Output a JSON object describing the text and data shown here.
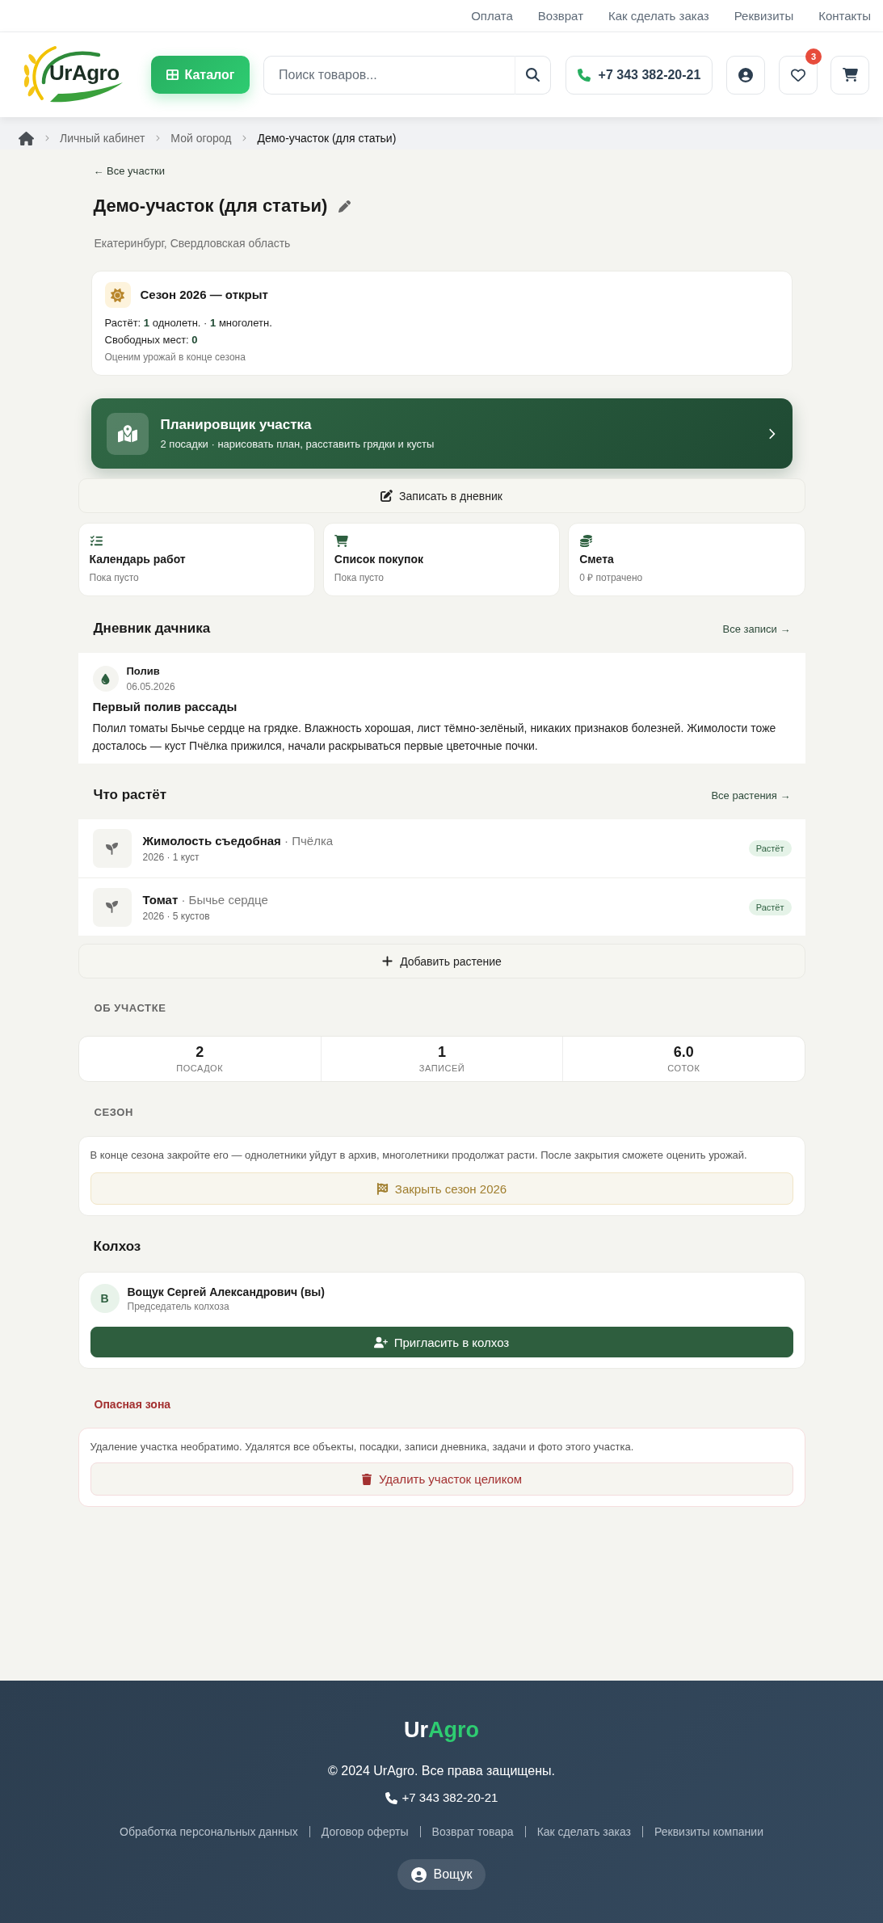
{
  "top_links": [
    "Оплата",
    "Возврат",
    "Как сделать заказ",
    "Реквизиты",
    "Контакты"
  ],
  "header": {
    "logo": "UrAgro",
    "catalog_button": "Каталог",
    "search": {
      "placeholder": "Поиск товаров..."
    },
    "phone": "+7 343 382-20-21",
    "wishlist_count": "3"
  },
  "breadcrumbs": [
    {
      "label": "Личный кабинет",
      "current": false
    },
    {
      "label": "Мой огород",
      "current": false
    },
    {
      "label": "Демо-участок (для статьи)",
      "current": true
    }
  ],
  "back_link": "← Все участки",
  "plot": {
    "title": "Демо-участок (для статьи)",
    "location": "Екатеринбург, Свердловская область"
  },
  "season_card": {
    "title": "Сезон 2026 — открыт",
    "growing": "Растёт: **1** однолетн. · **1** многолетн.",
    "free_spots": "Свободных мест: **0**",
    "note": "Оценим урожай в конце сезона"
  },
  "planner": {
    "title": "Планировщик участка",
    "subtitle": "2 посадки · нарисовать план, расставить грядки и кусты"
  },
  "diary_button": "Записать в дневник",
  "tools": [
    {
      "kind": "calendar",
      "title": "Календарь работ",
      "subtitle": "Пока пусто"
    },
    {
      "kind": "shopping",
      "title": "Список покупок",
      "subtitle": "Пока пусто"
    },
    {
      "kind": "budget",
      "title": "Смета",
      "subtitle": "0 ₽ потрачено"
    }
  ],
  "diary": {
    "heading": "Дневник дачника",
    "all_link": "Все записи →",
    "entries": [
      {
        "kind": "watering",
        "type_label": "Полив",
        "date": "06.05.2026",
        "title": "Первый полив рассады",
        "text": "Полил томаты Бычье сердце на грядке. Влажность хорошая, лист тёмно-зелёный, никаких признаков болезней. Жимолости тоже досталось — куст Пчёлка прижился, начали раскрываться первые цветочные почки."
      }
    ]
  },
  "plants": {
    "heading": "Что растёт",
    "all_link": "Все растения →",
    "items": [
      {
        "title": "**Жимолость съедобная** · Пчёлка",
        "meta": "2026 · 1 куст",
        "status": "Растёт"
      },
      {
        "title": "**Томат** · Бычье сердце",
        "meta": "2026 · 5 кустов",
        "status": "Растёт"
      }
    ],
    "add_button": "Добавить растение"
  },
  "about": {
    "heading": "ОБ УЧАСТКЕ",
    "stats": [
      {
        "value": "2",
        "label": "ПОСАДОК"
      },
      {
        "value": "1",
        "label": "ЗАПИСЕЙ"
      },
      {
        "value": "6.0",
        "label": "СОТОК"
      }
    ]
  },
  "season": {
    "heading": "СЕЗОН",
    "text": "В конце сезона закройте его — однолетники уйдут в архив, многолетники продолжат расти. После закрытия сможете оценить урожай.",
    "close_button": "Закрыть сезон 2026"
  },
  "kolkhoz": {
    "heading": "Колхоз",
    "members": [
      {
        "initial": "В",
        "name": "Вощук Сергей Александрович (вы)",
        "role": "Председатель колхоза"
      }
    ],
    "invite_button": "Пригласить в колхоз"
  },
  "danger_zone": {
    "heading": "Опасная зона",
    "text": "Удаление участка необратимо. Удалятся все объекты, посадки, записи дневника, задачи и фото этого участка.",
    "delete_button": "Удалить участок целиком"
  },
  "footer": {
    "logo": {
      "first": "Ur",
      "second": "Agro"
    },
    "copyright": "© 2024 UrAgro. Все права защищены.",
    "phone": "+7 343 382-20-21",
    "links": [
      "Обработка персональных данных",
      "Договор оферты",
      "Возврат товара",
      "Как сделать заказ",
      "Реквизиты компании"
    ],
    "user_button": "Вощук"
  }
}
